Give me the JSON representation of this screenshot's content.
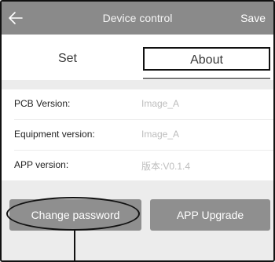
{
  "header": {
    "title": "Device control",
    "save_label": "Save",
    "back_icon": "arrow-left-icon"
  },
  "tabs": [
    {
      "label": "Set",
      "active": false
    },
    {
      "label": "About",
      "active": true
    }
  ],
  "info": [
    {
      "label": "PCB Version:",
      "value": "Image_A"
    },
    {
      "label": "Equipment version:",
      "value": "Image_A"
    },
    {
      "label": "APP version:",
      "value": "版本:V0.1.4"
    }
  ],
  "buttons": {
    "change_password": "Change password",
    "app_upgrade": "APP Upgrade"
  },
  "colors": {
    "header_bg": "#8a8a8a",
    "button_bg": "#8f8f8f",
    "value_text": "#bdbdbd"
  }
}
